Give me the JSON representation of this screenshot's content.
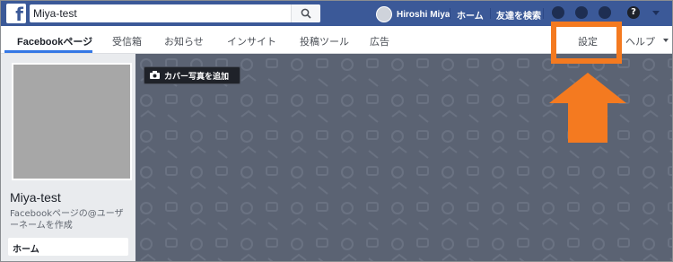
{
  "topbar": {
    "search_value": "Miya-test",
    "user_name": "Hiroshi Miya",
    "home_label": "ホーム",
    "find_friends_label": "友達を検索"
  },
  "subnav": {
    "tabs": [
      {
        "label": "Facebookページ"
      },
      {
        "label": "受信箱"
      },
      {
        "label": "お知らせ"
      },
      {
        "label": "インサイト"
      },
      {
        "label": "投稿ツール"
      },
      {
        "label": "広告"
      },
      {
        "label": "設定"
      },
      {
        "label": "ヘルプ"
      }
    ]
  },
  "cover": {
    "add_cover_label": "カバー写真を追加"
  },
  "left": {
    "page_name": "Miya-test",
    "username_link": "Facebookページの@ユーザーネームを作成",
    "home_item": "ホーム"
  },
  "annotation": {
    "color": "#f47a20"
  }
}
